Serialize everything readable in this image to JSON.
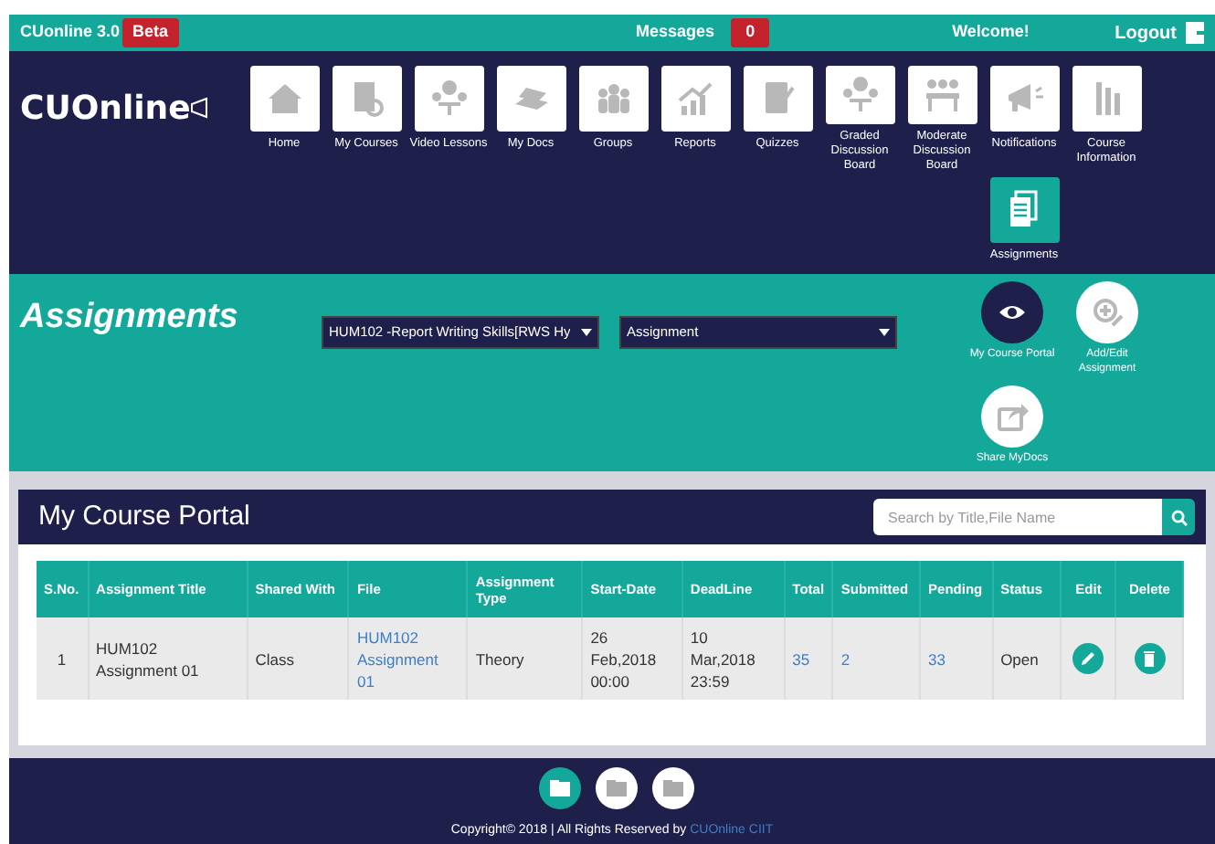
{
  "top_bar": {
    "app_name": "CUonline 3.0",
    "badge": "Beta",
    "messages_label": "Messages",
    "messages_count": "0",
    "welcome": "Welcome!",
    "logout": "Logout"
  },
  "logo": "CUOnline",
  "nav": [
    {
      "label": "Home",
      "selected": false
    },
    {
      "label": "My Courses",
      "selected": false
    },
    {
      "label": "Video Lessons",
      "selected": false
    },
    {
      "label": "My Docs",
      "selected": false
    },
    {
      "label": "Groups",
      "selected": false
    },
    {
      "label": "Reports",
      "selected": false
    },
    {
      "label": "Quizzes",
      "selected": false
    },
    {
      "label": "Graded Discussion Board",
      "selected": false
    },
    {
      "label": "Moderate Discussion Board",
      "selected": false
    },
    {
      "label": "Notifications",
      "selected": false
    },
    {
      "label": "Course Information",
      "selected": false
    },
    {
      "label": "Assignments",
      "selected": true
    }
  ],
  "section": {
    "title": "Assignments",
    "course_select": "HUM102 -Report Writing Skills[RWS Hy",
    "type_select": "Assignment",
    "actions": [
      {
        "label": "My Course Portal",
        "selected": true
      },
      {
        "label": "Add/Edit Assignment",
        "selected": false
      },
      {
        "label": "Share MyDocs",
        "selected": false
      }
    ]
  },
  "portal": {
    "title": "My Course Portal",
    "search": {
      "placeholder": "Search by Title,File Name"
    },
    "table": {
      "columns": [
        "S.No.",
        "Assignment Title",
        "Shared With",
        "File",
        "Assignment Type",
        "Start-Date",
        "DeadLine",
        "Total",
        "Submitted",
        "Pending",
        "Status",
        "Edit",
        "Delete"
      ],
      "rows": [
        {
          "sno": "1",
          "title": "HUM102 Assignment 01",
          "shared_with": "Class",
          "file": "HUM102 Assignment 01",
          "type": "Theory",
          "start": "26 Feb,2018 00:00",
          "deadline": "10 Mar,2018 23:59",
          "total": "35",
          "submitted": "2",
          "pending": "33",
          "status": "Open"
        }
      ]
    }
  },
  "footer": {
    "buttons": [
      {
        "selected": true
      },
      {
        "selected": false
      },
      {
        "selected": false
      }
    ],
    "copyright": "Copyright© 2018 | All Rights Reserved by",
    "link": "CUOnline CIIT"
  }
}
